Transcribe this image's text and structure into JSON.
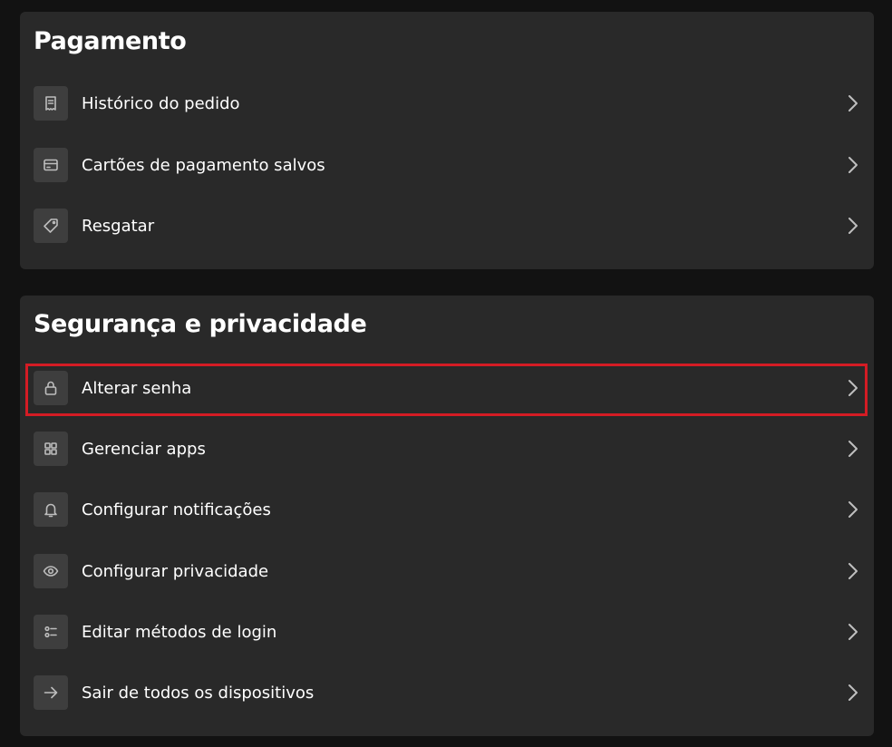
{
  "payment": {
    "title": "Pagamento",
    "items": [
      {
        "label": "Histórico do pedido",
        "icon": "receipt-icon"
      },
      {
        "label": "Cartões de pagamento salvos",
        "icon": "credit-card-icon"
      },
      {
        "label": "Resgatar",
        "icon": "tag-icon"
      }
    ]
  },
  "security": {
    "title": "Segurança e privacidade",
    "items": [
      {
        "label": "Alterar senha",
        "icon": "lock-icon",
        "highlighted": true
      },
      {
        "label": "Gerenciar apps",
        "icon": "grid-icon"
      },
      {
        "label": "Configurar notificações",
        "icon": "bell-icon"
      },
      {
        "label": "Configurar privacidade",
        "icon": "eye-icon"
      },
      {
        "label": "Editar métodos de login",
        "icon": "list-icon"
      },
      {
        "label": "Sair de todos os dispositivos",
        "icon": "arrow-right-icon"
      }
    ]
  },
  "colors": {
    "background": "#121212",
    "card": "#292929",
    "icon_tile": "#3e3e3e",
    "highlight": "#d41c24"
  }
}
